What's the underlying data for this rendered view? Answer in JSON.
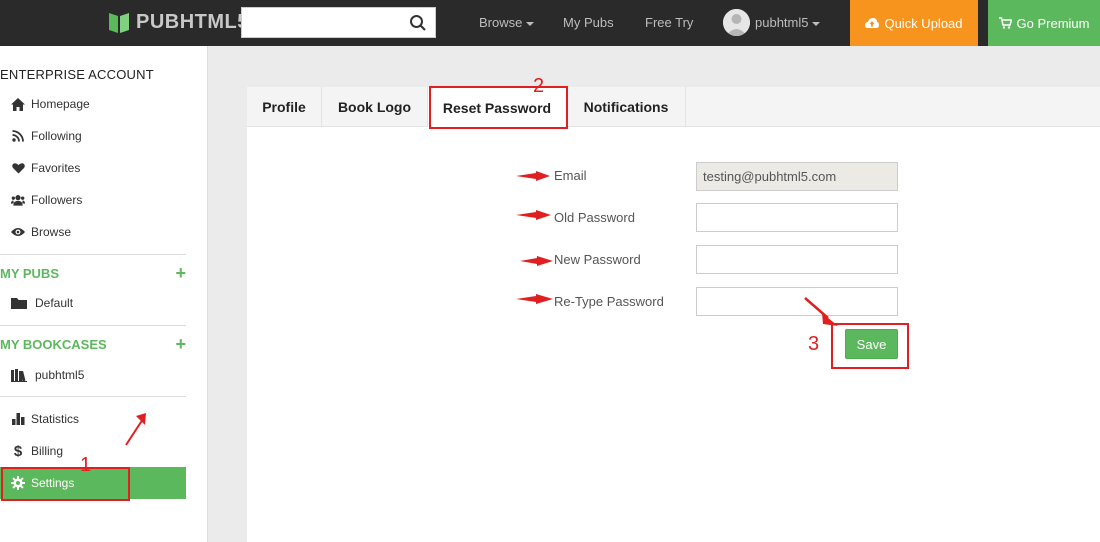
{
  "header": {
    "brand": "PUBHTML5",
    "search_placeholder": "",
    "nav": {
      "browse": "Browse",
      "my_pubs": "My Pubs",
      "free_try": "Free Try",
      "user": "pubhtml5"
    },
    "quick_upload": "Quick Upload",
    "go_premium": "Go Premium",
    "colors": {
      "upload": "#f7941d",
      "premium": "#5cb85c"
    }
  },
  "sidebar": {
    "account_title": "ENTERPRISE ACCOUNT",
    "items": [
      {
        "label": "Homepage",
        "icon": "home-icon"
      },
      {
        "label": "Following",
        "icon": "rss-icon"
      },
      {
        "label": "Favorites",
        "icon": "heart-icon"
      },
      {
        "label": "Followers",
        "icon": "users-icon"
      },
      {
        "label": "Browse",
        "icon": "eye-icon"
      }
    ],
    "my_pubs": {
      "title": "MY PUBS",
      "items": [
        {
          "label": "Default",
          "icon": "folder-icon"
        }
      ]
    },
    "my_bookcases": {
      "title": "MY BOOKCASES",
      "items": [
        {
          "label": "pubhtml5",
          "icon": "bookcase-icon"
        }
      ]
    },
    "bottom_items": [
      {
        "label": "Statistics",
        "icon": "bar-chart-icon"
      },
      {
        "label": "Billing",
        "icon": "dollar-icon"
      },
      {
        "label": "Settings",
        "icon": "gear-icon",
        "active": true
      }
    ]
  },
  "tabs": [
    "Profile",
    "Book Logo",
    "Reset Password",
    "Notifications"
  ],
  "active_tab": "Reset Password",
  "form": {
    "email_label": "Email",
    "email_value": "testing@pubhtml5.com",
    "old_password_label": "Old Password",
    "new_password_label": "New Password",
    "retype_password_label": "Re-Type Password",
    "save_label": "Save"
  },
  "annotations": {
    "step1": "1",
    "step2": "2",
    "step3": "3",
    "color": "#e02020"
  }
}
